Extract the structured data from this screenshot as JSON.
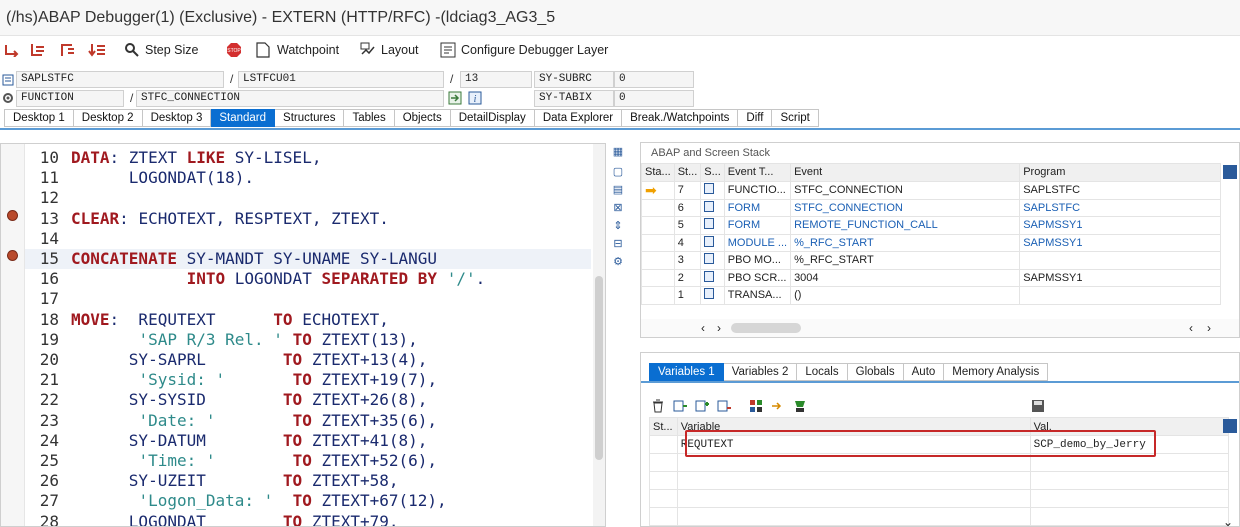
{
  "window": {
    "title": "(/hs)ABAP Debugger(1)  (Exclusive) - EXTERN (HTTP/RFC) -(ldciag3_AG3_5"
  },
  "toolbar": {
    "step_size": "Step Size",
    "watchpoint": "Watchpoint",
    "layout": "Layout",
    "configure": "Configure Debugger Layer"
  },
  "fields": {
    "program": "SAPLSTFC",
    "include": "LSTFCU01",
    "line": "13",
    "subrc_label": "SY-SUBRC",
    "subrc_value": "0",
    "event_type": "FUNCTION",
    "event": "STFC_CONNECTION",
    "tabix_label": "SY-TABIX",
    "tabix_value": "0",
    "sep1": "/",
    "sep2": "/",
    "sep3": "/"
  },
  "tabs": [
    "Desktop 1",
    "Desktop 2",
    "Desktop 3",
    "Standard",
    "Structures",
    "Tables",
    "Objects",
    "DetailDisplay",
    "Data Explorer",
    "Break./Watchpoints",
    "Diff",
    "Script"
  ],
  "code": [
    {
      "n": "10",
      "t": [
        [
          "kw",
          "DATA"
        ],
        [
          "p",
          ": ZTEXT "
        ],
        [
          "kw",
          "LIKE"
        ],
        [
          "p",
          " SY-LISEL,"
        ]
      ]
    },
    {
      "n": "11",
      "t": [
        [
          "p",
          "      LOGONDAT(18)."
        ]
      ]
    },
    {
      "n": "12",
      "t": []
    },
    {
      "n": "13",
      "t": [
        [
          "kw",
          "CLEAR"
        ],
        [
          "p",
          ": ECHOTEXT, RESPTEXT, ZTEXT."
        ]
      ]
    },
    {
      "n": "14",
      "t": []
    },
    {
      "n": "15",
      "t": [
        [
          "kw",
          "CONCATENATE"
        ],
        [
          "p",
          " SY-MANDT SY-UNAME SY-LANGU"
        ]
      ]
    },
    {
      "n": "16",
      "t": [
        [
          "p",
          "            "
        ],
        [
          "kw",
          "INTO"
        ],
        [
          "p",
          " LOGONDAT "
        ],
        [
          "kw",
          "SEPARATED BY"
        ],
        [
          "p",
          " "
        ],
        [
          "st",
          "'/'"
        ],
        [
          "p",
          "."
        ]
      ]
    },
    {
      "n": "17",
      "t": []
    },
    {
      "n": "18",
      "t": [
        [
          "kw",
          "MOVE"
        ],
        [
          "p",
          ":  REQUTEXT      "
        ],
        [
          "kw",
          "TO"
        ],
        [
          "p",
          " ECHOTEXT,"
        ]
      ]
    },
    {
      "n": "19",
      "t": [
        [
          "p",
          "       "
        ],
        [
          "st",
          "'SAP R/3 Rel. '"
        ],
        [
          "p",
          " "
        ],
        [
          "kw",
          "TO"
        ],
        [
          "p",
          " ZTEXT(13),"
        ]
      ]
    },
    {
      "n": "20",
      "t": [
        [
          "p",
          "      SY-SAPRL        "
        ],
        [
          "kw",
          "TO"
        ],
        [
          "p",
          " ZTEXT+13(4),"
        ]
      ]
    },
    {
      "n": "21",
      "t": [
        [
          "p",
          "       "
        ],
        [
          "st",
          "'Sysid: '"
        ],
        [
          "p",
          "       "
        ],
        [
          "kw",
          "TO"
        ],
        [
          "p",
          " ZTEXT+19(7),"
        ]
      ]
    },
    {
      "n": "22",
      "t": [
        [
          "p",
          "      SY-SYSID        "
        ],
        [
          "kw",
          "TO"
        ],
        [
          "p",
          " ZTEXT+26(8),"
        ]
      ]
    },
    {
      "n": "23",
      "t": [
        [
          "p",
          "       "
        ],
        [
          "st",
          "'Date: '"
        ],
        [
          "p",
          "        "
        ],
        [
          "kw",
          "TO"
        ],
        [
          "p",
          " ZTEXT+35(6),"
        ]
      ]
    },
    {
      "n": "24",
      "t": [
        [
          "p",
          "      SY-DATUM        "
        ],
        [
          "kw",
          "TO"
        ],
        [
          "p",
          " ZTEXT+41(8),"
        ]
      ]
    },
    {
      "n": "25",
      "t": [
        [
          "p",
          "       "
        ],
        [
          "st",
          "'Time: '"
        ],
        [
          "p",
          "        "
        ],
        [
          "kw",
          "TO"
        ],
        [
          "p",
          " ZTEXT+52(6),"
        ]
      ]
    },
    {
      "n": "26",
      "t": [
        [
          "p",
          "      SY-UZEIT        "
        ],
        [
          "kw",
          "TO"
        ],
        [
          "p",
          " ZTEXT+58,"
        ]
      ]
    },
    {
      "n": "27",
      "t": [
        [
          "p",
          "       "
        ],
        [
          "st",
          "'Logon_Data: '"
        ],
        [
          "p",
          "  "
        ],
        [
          "kw",
          "TO"
        ],
        [
          "p",
          " ZTEXT+67(12),"
        ]
      ]
    },
    {
      "n": "28",
      "t": [
        [
          "p",
          "      LOGONDAT        "
        ],
        [
          "kw",
          "TO"
        ],
        [
          "p",
          " ZTEXT+79."
        ]
      ]
    }
  ],
  "stack": {
    "title": "ABAP and Screen Stack",
    "headers": [
      "Sta...",
      "St...",
      "S...",
      "Event T...",
      "Event",
      "Program"
    ],
    "rows": [
      {
        "lvl": "7",
        "type": "FUNCTIO...",
        "event": "STFC_CONNECTION",
        "prog": "SAPLSTFC",
        "blue": false,
        "cur": true
      },
      {
        "lvl": "6",
        "type": "FORM",
        "event": "STFC_CONNECTION",
        "prog": "SAPLSTFC",
        "blue": true,
        "cur": false
      },
      {
        "lvl": "5",
        "type": "FORM",
        "event": "REMOTE_FUNCTION_CALL",
        "prog": "SAPMSSY1",
        "blue": true,
        "cur": false
      },
      {
        "lvl": "4",
        "type": "MODULE ...",
        "event": "%_RFC_START",
        "prog": "SAPMSSY1",
        "blue": true,
        "cur": false
      },
      {
        "lvl": "3",
        "type": "PBO MO...",
        "event": "%_RFC_START",
        "prog": "",
        "blue": false,
        "cur": false
      },
      {
        "lvl": "2",
        "type": "PBO SCR...",
        "event": "3004",
        "prog": "SAPMSSY1",
        "blue": false,
        "cur": false
      },
      {
        "lvl": "1",
        "type": "TRANSA...",
        "event": "()",
        "prog": "",
        "blue": false,
        "cur": false
      }
    ]
  },
  "variables": {
    "tabs": [
      "Variables 1",
      "Variables 2",
      "Locals",
      "Globals",
      "Auto",
      "Memory Analysis"
    ],
    "headers": [
      "St...",
      "Variable",
      "Val."
    ],
    "rows": [
      {
        "name": "REQUTEXT",
        "value": "SCP_demo_by_Jerry"
      }
    ]
  },
  "colors": {
    "accent": "#0a6ed1",
    "keyword": "#a0191f",
    "string": "#2e8a8a",
    "highlight": "#c62828"
  }
}
